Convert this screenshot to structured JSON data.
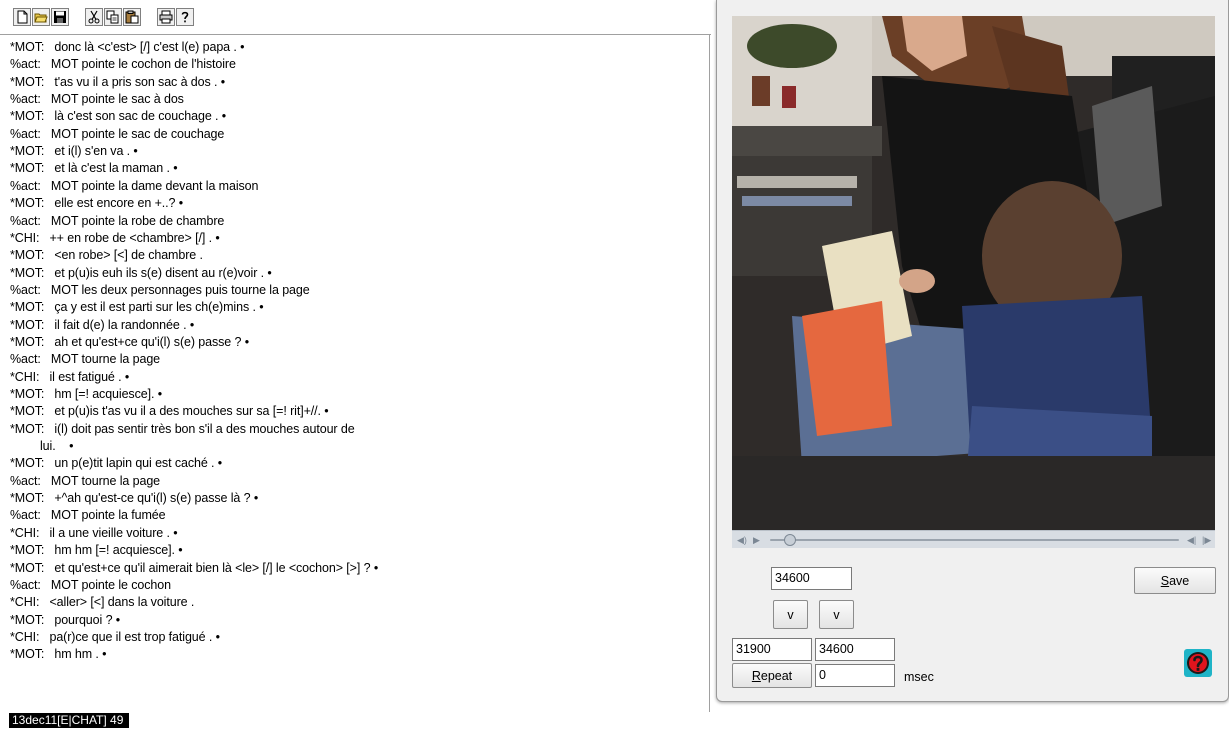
{
  "toolbar": {
    "buttons": [
      {
        "name": "new-file-icon"
      },
      {
        "name": "open-folder-icon"
      },
      {
        "name": "save-disk-icon"
      },
      {
        "name": "cut-scissors-icon"
      },
      {
        "name": "copy-icon"
      },
      {
        "name": "paste-icon"
      },
      {
        "name": "print-icon"
      },
      {
        "name": "help-question-icon"
      }
    ]
  },
  "transcript": {
    "lines": [
      {
        "text": "*MOT:   donc là <c'est> [/] c'est l(e) papa . •",
        "indent": false
      },
      {
        "text": "%act:   MOT pointe le cochon de l'histoire",
        "indent": false
      },
      {
        "text": "*MOT:   t'as vu il a pris son sac à dos . •",
        "indent": false
      },
      {
        "text": "%act:   MOT pointe le sac à dos",
        "indent": false
      },
      {
        "text": "*MOT:   là c'est son sac de couchage . •",
        "indent": false
      },
      {
        "text": "%act:   MOT pointe le sac de couchage",
        "indent": false
      },
      {
        "text": "*MOT:   et i(l) s'en va . •",
        "indent": false
      },
      {
        "text": "*MOT:   et là c'est la maman . •",
        "indent": false
      },
      {
        "text": "%act:   MOT pointe la dame devant la maison",
        "indent": false
      },
      {
        "text": "*MOT:   elle est encore en +..? •",
        "indent": false
      },
      {
        "text": "%act:   MOT pointe la robe de chambre",
        "indent": false
      },
      {
        "text": "*CHI:   ++ en robe de <chambre> [/] . •",
        "indent": false
      },
      {
        "text": "*MOT:   <en robe> [<] de chambre .",
        "indent": false
      },
      {
        "text": "*MOT:   et p(u)is euh ils s(e) disent au r(e)voir . •",
        "indent": false
      },
      {
        "text": "%act:   MOT les deux personnages puis tourne la page",
        "indent": false
      },
      {
        "text": "*MOT:   ça y est il est parti sur les ch(e)mins . •",
        "indent": false
      },
      {
        "text": "*MOT:   il fait d(e) la randonnée . •",
        "indent": false
      },
      {
        "text": "*MOT:   ah et qu'est+ce qu'i(l) s(e) passe ? •",
        "indent": false
      },
      {
        "text": "%act:   MOT tourne la page",
        "indent": false
      },
      {
        "text": "*CHI:   il est fatigué . •",
        "indent": false
      },
      {
        "text": "*MOT:   hm [=! acquiesce]. •",
        "indent": false
      },
      {
        "text": "*MOT:   et p(u)is t'as vu il a des mouches sur sa [=! rit]+//. •",
        "indent": false
      },
      {
        "text": "*MOT:   i(l) doit pas sentir très bon s'il a des mouches autour de",
        "indent": false
      },
      {
        "text": "lui.    •",
        "indent": true
      },
      {
        "text": "*MOT:   un p(e)tit lapin qui est caché . •",
        "indent": false
      },
      {
        "text": "%act:   MOT tourne la page",
        "indent": false
      },
      {
        "text": "*MOT:   +^ah qu'est-ce qu'i(l) s(e) passe là ? •",
        "indent": false
      },
      {
        "text": "%act:   MOT pointe la fumée",
        "indent": false
      },
      {
        "text": "*CHI:   il a une vieille voiture . •",
        "indent": false
      },
      {
        "text": "*MOT:   hm hm [=! acquiesce]. •",
        "indent": false
      },
      {
        "text": "*MOT:   et qu'est+ce qu'il aimerait bien là <le> [/] le <cochon> [>] ? •",
        "indent": false
      },
      {
        "text": "%act:   MOT pointe le cochon",
        "indent": false
      },
      {
        "text": "*CHI:   <aller> [<] dans la voiture .",
        "indent": false
      },
      {
        "text": "*MOT:   pourquoi ? •",
        "indent": false
      },
      {
        "text": "*CHI:   pa(r)ce que il est trop fatigué . •",
        "indent": false
      },
      {
        "text": "*MOT:   hm hm . •",
        "indent": false
      }
    ]
  },
  "status_bar": {
    "text": "13dec11[E|CHAT]   49"
  },
  "media": {
    "seek_position": 0.05,
    "current_time": "34600",
    "save_label_mnemonic": "S",
    "save_label_rest": "ave",
    "down_button_1": "v",
    "down_button_2": "v",
    "start_time": "31900",
    "end_time": "34600",
    "repeat_label_mnemonic": "R",
    "repeat_label_rest": "epeat",
    "repeat_value": "0",
    "msec_label": "msec"
  },
  "colors": {
    "status_bg": "#000000",
    "status_fg": "#ffffff",
    "help_icon_bg": "#1fb4c7",
    "help_icon_fg": "#e0141d"
  }
}
